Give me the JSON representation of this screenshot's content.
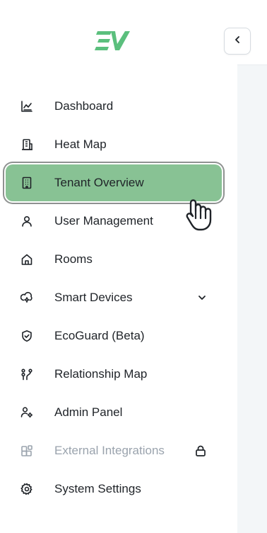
{
  "brand": {
    "logo_text": "EV",
    "color": "#5bbf7d"
  },
  "colors": {
    "active_bg": "#88c294",
    "disabled_text": "#9aa3ad",
    "text": "#1f2328"
  },
  "nav": {
    "items": [
      {
        "label": "Dashboard",
        "icon": "chart-icon"
      },
      {
        "label": "Heat Map",
        "icon": "building-icon"
      },
      {
        "label": "Tenant Overview",
        "icon": "office-building-icon",
        "active": true
      },
      {
        "label": "User Management",
        "icon": "user-icon"
      },
      {
        "label": "Rooms",
        "icon": "home-icon"
      },
      {
        "label": "Smart Devices",
        "icon": "smart-device-icon",
        "trailing": "chevron-down-icon"
      },
      {
        "label": "EcoGuard (Beta)",
        "icon": "shield-check-icon"
      },
      {
        "label": "Relationship Map",
        "icon": "relationship-map-icon"
      },
      {
        "label": "Admin Panel",
        "icon": "admin-user-icon"
      },
      {
        "label": "External Integrations",
        "icon": "integrations-icon",
        "trailing": "lock-icon",
        "disabled": true
      },
      {
        "label": "System Settings",
        "icon": "gear-icon"
      }
    ]
  },
  "collapse_button": {
    "icon": "chevron-left-icon"
  }
}
